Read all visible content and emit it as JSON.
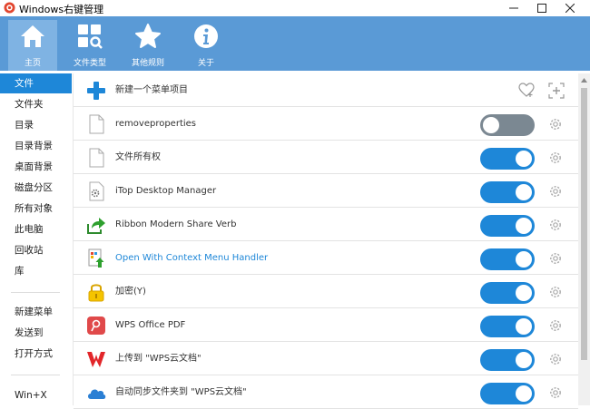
{
  "window": {
    "title": "Windows右键管理",
    "minimize_glyph": "—",
    "maximize_glyph": "☐",
    "close_glyph": "✕"
  },
  "toolbar": [
    {
      "label": "主页",
      "icon": "home-icon",
      "active": true
    },
    {
      "label": "文件类型",
      "icon": "file-types-icon",
      "active": false
    },
    {
      "label": "其他规则",
      "icon": "star-icon",
      "active": false
    },
    {
      "label": "关于",
      "icon": "info-icon",
      "active": false
    }
  ],
  "sidebar": {
    "items": [
      {
        "label": "文件",
        "active": true
      },
      {
        "label": "文件夹"
      },
      {
        "label": "目录"
      },
      {
        "label": "目录背景"
      },
      {
        "label": "桌面背景"
      },
      {
        "label": "磁盘分区"
      },
      {
        "label": "所有对象"
      },
      {
        "label": "此电脑"
      },
      {
        "label": "回收站"
      },
      {
        "label": "库"
      },
      {
        "label": "新建菜单"
      },
      {
        "label": "发送到"
      },
      {
        "label": "打开方式"
      },
      {
        "label": "Win+X"
      }
    ]
  },
  "main": {
    "new_item_label": "新建一个菜单项目",
    "rows": [
      {
        "label": "removeproperties",
        "icon": "blank-file-icon",
        "enabled": false
      },
      {
        "label": "文件所有权",
        "icon": "blank-file-icon",
        "enabled": true
      },
      {
        "label": "iTop Desktop Manager",
        "icon": "gear-file-icon",
        "enabled": true
      },
      {
        "label": "Ribbon Modern Share Verb",
        "icon": "share-arrow-icon",
        "enabled": true
      },
      {
        "label": "Open With Context Menu Handler",
        "icon": "open-with-icon",
        "enabled": true,
        "link": true
      },
      {
        "label": "加密(Y)",
        "icon": "lock-icon",
        "enabled": true
      },
      {
        "label": "WPS Office PDF",
        "icon": "wps-pdf-icon",
        "enabled": true
      },
      {
        "label": "上传到 \"WPS云文档\"",
        "icon": "wps-logo-icon",
        "enabled": true
      },
      {
        "label": "自动同步文件夹到 \"WPS云文档\"",
        "icon": "cloud-icon",
        "enabled": true
      }
    ]
  },
  "colors": {
    "toolbar": "#5a9ad6",
    "accent": "#1e87d8",
    "toggle_off": "#7b8892"
  }
}
